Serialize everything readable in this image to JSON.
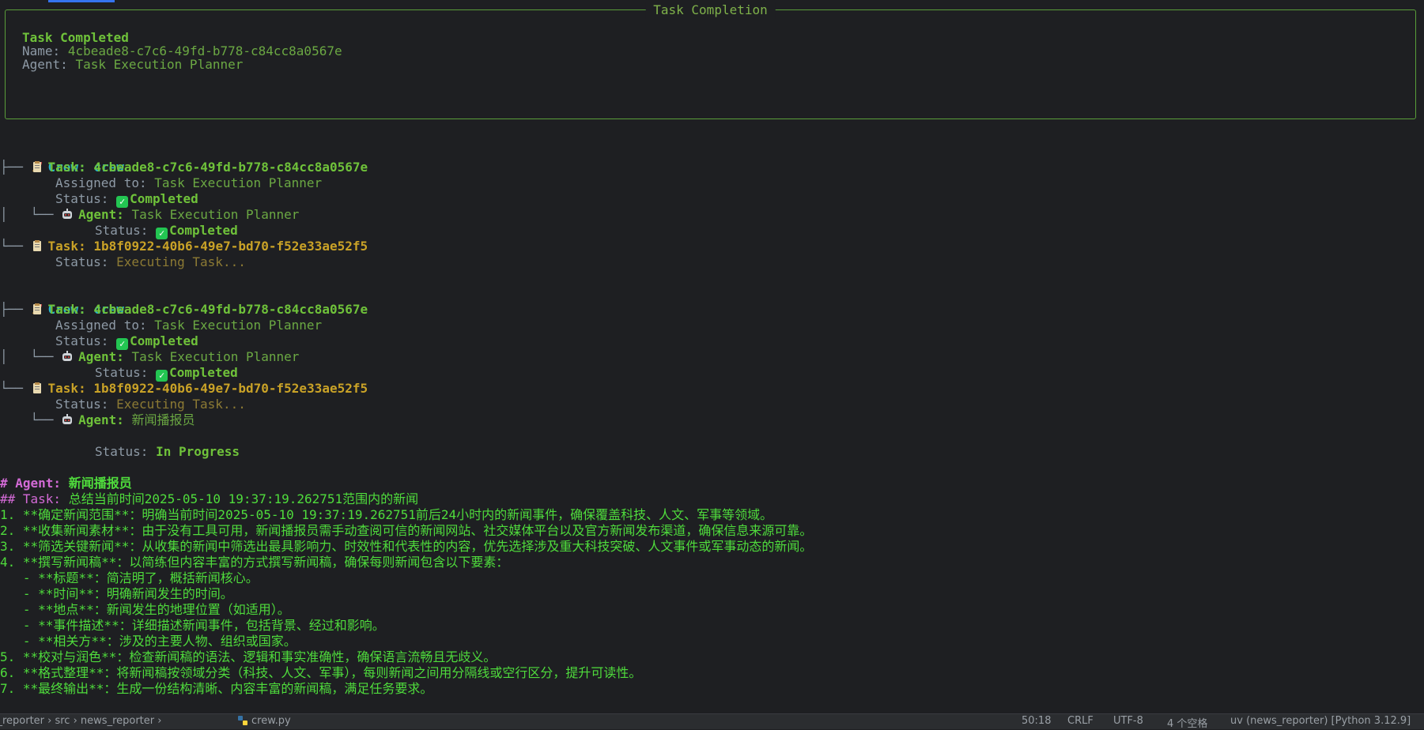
{
  "panel": {
    "title": "Task Completion",
    "heading": "Task Completed",
    "name_label": "Name:",
    "name_value": "4cbeade8-c7c6-49fd-b778-c84cc8a0567e",
    "agent_label": "Agent:",
    "agent_value": "Task Execution Planner"
  },
  "tree1": {
    "crew_label": "Crew:",
    "crew_value": "crew",
    "task1_label": "Task:",
    "task1_id": "4cbeade8-c7c6-49fd-b778-c84cc8a0567e",
    "assigned_label": "Assigned to:",
    "assigned_value": "Task Execution Planner",
    "status_label": "Status:",
    "completed": "Completed",
    "agent_label": "Agent:",
    "agent_value": "Task Execution Planner",
    "task2_label": "Task:",
    "task2_id": "1b8f0922-40b6-49e7-bd70-f52e33ae52f5",
    "executing": "Executing Task..."
  },
  "tree2": {
    "crew_label": "Crew:",
    "crew_value": "crew",
    "task1_label": "Task:",
    "task1_id": "4cbeade8-c7c6-49fd-b778-c84cc8a0567e",
    "assigned_label": "Assigned to:",
    "assigned_value": "Task Execution Planner",
    "status_label": "Status:",
    "completed": "Completed",
    "agent_label": "Agent:",
    "agent_value": "Task Execution Planner",
    "task2_label": "Task:",
    "task2_id": "1b8f0922-40b6-49e7-bd70-f52e33ae52f5",
    "executing": "Executing Task...",
    "agent2_value": "新闻播报员",
    "in_progress": "In Progress"
  },
  "output": {
    "agent_header_label": "# Agent:",
    "agent_header_value": "新闻播报员",
    "task_header_label": "## Task:",
    "task_header_value": "总结当前时间2025-05-10 19:37:19.262751范围内的新闻",
    "lines": [
      "1. **确定新闻范围**：明确当前时间2025-05-10 19:37:19.262751前后24小时内的新闻事件，确保覆盖科技、人文、军事等领域。",
      "2. **收集新闻素材**：由于没有工具可用，新闻播报员需手动查阅可信的新闻网站、社交媒体平台以及官方新闻发布渠道，确保信息来源可靠。",
      "3. **筛选关键新闻**：从收集的新闻中筛选出最具影响力、时效性和代表性的内容，优先选择涉及重大科技突破、人文事件或军事动态的新闻。",
      "4. **撰写新闻稿**：以简练但内容丰富的方式撰写新闻稿，确保每则新闻包含以下要素：",
      "   - **标题**：简洁明了，概括新闻核心。",
      "   - **时间**：明确新闻发生的时间。",
      "   - **地点**：新闻发生的地理位置（如适用）。",
      "   - **事件描述**：详细描述新闻事件，包括背景、经过和影响。",
      "   - **相关方**：涉及的主要人物、组织或国家。",
      "5. **校对与润色**：检查新闻稿的语法、逻辑和事实准确性，确保语言流畅且无歧义。",
      "6. **格式整理**：将新闻稿按领域分类（科技、人文、军事），每则新闻之间用分隔线或空行区分，提升可读性。",
      "7. **最终输出**：生成一份结构清晰、内容丰富的新闻稿，满足任务要求。"
    ]
  },
  "statusbar": {
    "breadcrumb": "vs_reporter  ›  src  ›  news_reporter  ›",
    "file": "crew.py",
    "position": "50:18",
    "line_ending": "CRLF",
    "encoding": "UTF-8",
    "indent": "4 个空格",
    "interpreter": "uv (news_reporter) [Python 3.12.9]"
  }
}
